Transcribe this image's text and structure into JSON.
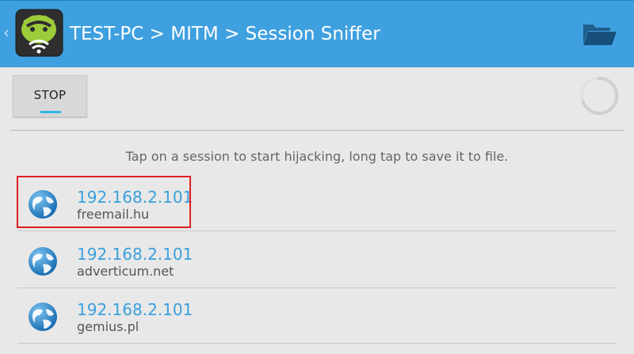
{
  "actionbar": {
    "title": "TEST-PC > MITM > Session Sniffer",
    "app_icon": "android-wifi-icon",
    "back_icon": "chevron-left-icon",
    "action_icon": "folder-open-icon"
  },
  "controls": {
    "stop_label": "STOP",
    "spinner_icon": "progress-spinner-icon"
  },
  "hint": "Tap on a session to start hijacking, long tap to save it to file.",
  "sessions": [
    {
      "ip": "192.168.2.101",
      "host": "freemail.hu",
      "icon": "globe-icon",
      "highlighted": true
    },
    {
      "ip": "192.168.2.101",
      "host": "adverticum.net",
      "icon": "globe-icon",
      "highlighted": false
    },
    {
      "ip": "192.168.2.101",
      "host": "gemius.pl",
      "icon": "globe-icon",
      "highlighted": false
    }
  ],
  "colors": {
    "actionbar": "#3fa0df",
    "accent": "#33b5e5",
    "link": "#3aa0dc",
    "highlight_border": "#e02020",
    "background": "#e8e8e8"
  }
}
